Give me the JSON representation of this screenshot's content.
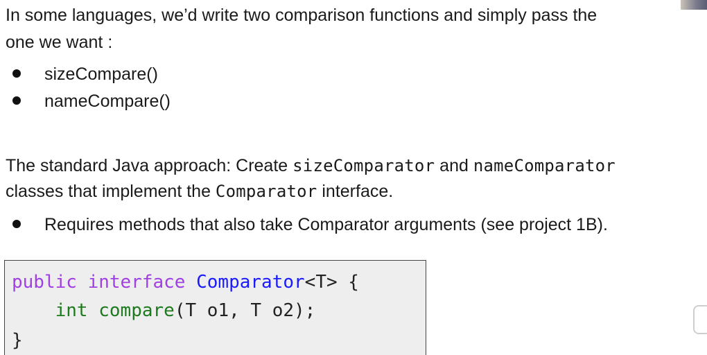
{
  "para1": {
    "line1": "In some languages, we’d write two comparison functions and simply pass the",
    "line2": "one we want :"
  },
  "bullets1": [
    "sizeCompare()",
    "nameCompare()"
  ],
  "para2": {
    "prefix": "The standard Java approach: Create ",
    "code1": "sizeComparator",
    "middle": " and ",
    "code2": "nameComparator",
    "line2_prefix": "classes that implement the ",
    "code3": "Comparator",
    "line2_suffix": " interface."
  },
  "bullets2": [
    "Requires methods that also take Comparator arguments (see project 1B)."
  ],
  "code": {
    "l1_kw1": "public",
    "l1_kw2": "interface",
    "l1_name": "Comparator",
    "l1_rest": "<T> {",
    "l2_type": "int",
    "l2_method": "compare",
    "l2_rest": "(T o1, T o2);",
    "l3": "}"
  }
}
